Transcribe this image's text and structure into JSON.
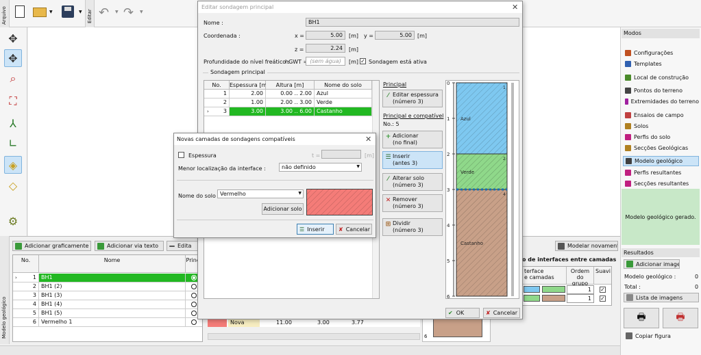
{
  "toolbar": {
    "side_tab": "Arquivo",
    "edit_tab": "Editar"
  },
  "left_tools": [
    "move-icon",
    "move-cross-icon",
    "zoom-icon",
    "fit-icon",
    "axes-3d-icon",
    "axes-2d-icon",
    "cube-icon",
    "cube-outline-icon",
    "settings-icon"
  ],
  "right_panel": {
    "title": "Modos",
    "items": [
      {
        "label": "Configurações",
        "icon": "config-icon",
        "color": "#c05020"
      },
      {
        "label": "Templates",
        "icon": "templates-icon",
        "color": "#3060b0"
      },
      {
        "label": "Local de construção",
        "icon": "site-icon",
        "color": "#4a8a2a"
      },
      {
        "label": "Pontos do terreno",
        "icon": "points-icon",
        "color": "#444444"
      },
      {
        "label": "Extremidades do terreno",
        "icon": "edges-icon",
        "color": "#a020a0"
      },
      {
        "label": "Ensaios de campo",
        "icon": "field-tests-icon",
        "color": "#c04040"
      },
      {
        "label": "Solos",
        "icon": "soils-icon",
        "color": "#b08020"
      },
      {
        "label": "Perfis do solo",
        "icon": "soil-profiles-icon",
        "color": "#c02080"
      },
      {
        "label": "Secções Geológicas",
        "icon": "geo-sections-icon",
        "color": "#b08020"
      },
      {
        "label": "Modelo geológico",
        "icon": "geo-model-icon",
        "color": "#404040"
      },
      {
        "label": "Perfis resultantes",
        "icon": "result-profiles-icon",
        "color": "#c02080"
      },
      {
        "label": "Secções resultantes",
        "icon": "result-sections-icon",
        "color": "#c02080"
      }
    ],
    "info": "Modelo geológico gerado.",
    "results_title": "Resultados",
    "add_image": "Adicionar imagem",
    "geo_model_label": "Modelo geológico :",
    "geo_model_value": "0",
    "total_label": "Total :",
    "total_value": "0",
    "image_list": "Lista de imagens",
    "copy_figure": "Copiar figura"
  },
  "bottom": {
    "side_tab": "Modelo geológico",
    "add_graphic": "Adicionar graficamente",
    "add_text": "Adicionar via texto",
    "edit": "Edita",
    "remodel": "Modelar novamente",
    "col_no": "No.",
    "col_name": "Nome",
    "col_main": "Princi",
    "rows": [
      {
        "no": "1",
        "name": "BH1"
      },
      {
        "no": "2",
        "name": "BH1 (2)"
      },
      {
        "no": "3",
        "name": "BH1 (3)"
      },
      {
        "no": "4",
        "name": "BH1 (4)"
      },
      {
        "no": "5",
        "name": "BH1 (5)"
      },
      {
        "no": "6",
        "name": "Vermelho 1"
      }
    ],
    "peek_nova": "Nova",
    "peek_v1": "11.00",
    "peek_v2": "3.00",
    "peek_v3": "3.77",
    "interfaces_title": "o de interfaces entre camadas",
    "iface_h1": "terface",
    "iface_h1b": "e camadas",
    "iface_h2": "Ordem do",
    "iface_h2b": "grupo",
    "iface_h3": "Suavi",
    "iface_rows": [
      {
        "order": "1"
      },
      {
        "order": "1"
      }
    ]
  },
  "dialog": {
    "title": "Editar sondagem principal",
    "name_label": "Nome :",
    "name_value": "BH1",
    "coord_label": "Coordenada :",
    "x_label": "x =",
    "x_value": "5.00",
    "unit_m": "[m]",
    "y_label": "y =",
    "y_value": "5.00",
    "z_label": "z =",
    "z_value": "2.24",
    "water_label": "Profundidade do nível freático :",
    "hgwt_label": "hGWT =",
    "hgwt_placeholder": "(sem água)",
    "active_label": "Sondagem está ativa",
    "group_title": "Sondagem principal",
    "table_headers": [
      "No.",
      "Espessura [m]",
      "Altura [m]",
      "Nome do solo"
    ],
    "rows": [
      {
        "no": "1",
        "thick": "2.00",
        "height": "0.00 .. 2.00",
        "soil": "Azul"
      },
      {
        "no": "2",
        "thick": "1.00",
        "height": "2.00 .. 3.00",
        "soil": "Verde"
      },
      {
        "no": "3",
        "thick": "3.00",
        "height": "3.00 .. 6.00",
        "soil": "Castanho"
      }
    ],
    "right_title": "Principal",
    "edit_thick": "Editar espessura",
    "edit_thick_sub": "(número 3)",
    "compat_title": "Principal e compatível",
    "compat_no": "No.: 5",
    "add": "Adicionar",
    "add_sub": "(no final)",
    "insert": "Inserir",
    "insert_sub": "(antes 3)",
    "change_soil": "Alterar solo",
    "change_soil_sub": "(número 3)",
    "remove": "Remover",
    "remove_sub": "(número 3)",
    "split": "Dividir",
    "split_sub": "(número 3)",
    "ok": "OK",
    "cancel": "Cancelar"
  },
  "profile": {
    "ticks": [
      "0",
      "1",
      "2",
      "3",
      "4",
      "5",
      "6"
    ],
    "layers": [
      {
        "name": "Azul",
        "from": 0,
        "to": 2,
        "color": "#7ec8f0",
        "num": "1"
      },
      {
        "name": "Verde",
        "from": 2,
        "to": 3,
        "color": "#8fd88a",
        "num": "2"
      },
      {
        "name": "Castanho",
        "from": 3,
        "to": 6,
        "color": "#c8a088",
        "num": "4"
      }
    ]
  },
  "subdialog": {
    "title": "Novas camadas de sondagens compatíveis",
    "thickness_label": "Espessura",
    "t_label": "t =",
    "unit_m": "[m]",
    "min_loc_label": "Menor localização da interface :",
    "min_loc_value": "não definido",
    "soil_label": "Nome do solo :",
    "soil_value": "Vermelho",
    "add_soil": "Adicionar solo",
    "insert": "Inserir",
    "cancel": "Cancelar",
    "swatch_color": "#f47c78"
  }
}
